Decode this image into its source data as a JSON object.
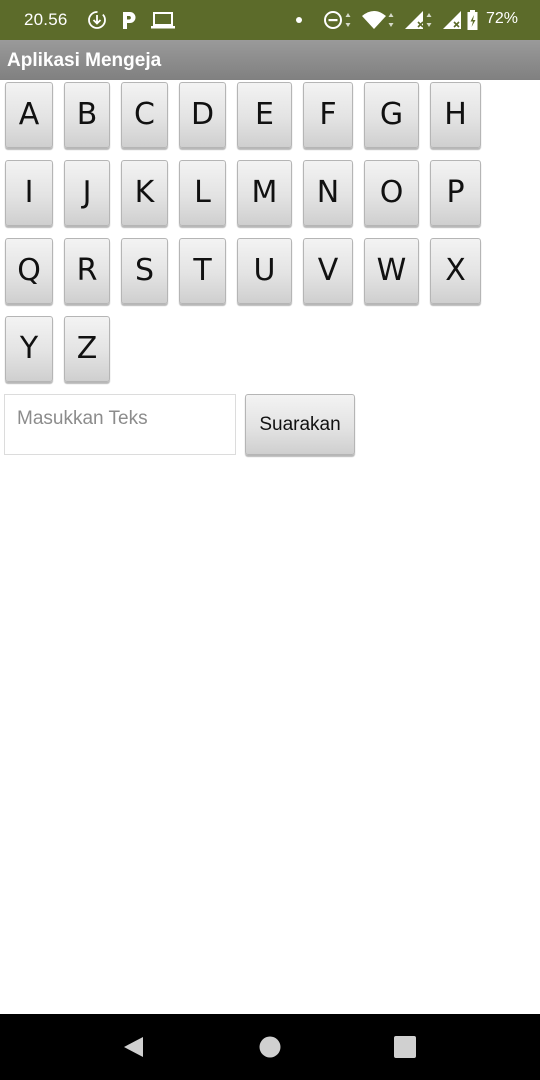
{
  "status_bar": {
    "time": "20.56",
    "battery": "72%",
    "icons": [
      "download-icon",
      "parking-p-icon",
      "laptop-icon",
      "notification-dot-icon",
      "do-not-disturb-icon",
      "wifi-icon",
      "signal-icon",
      "signal-no-sim-icon",
      "battery-icon"
    ],
    "background": "#5c6b2a"
  },
  "title_bar": {
    "title": "Aplikasi Mengeja"
  },
  "letters": [
    "A",
    "B",
    "C",
    "D",
    "E",
    "F",
    "G",
    "H",
    "I",
    "J",
    "K",
    "L",
    "M",
    "N",
    "O",
    "P",
    "Q",
    "R",
    "S",
    "T",
    "U",
    "V",
    "W",
    "X",
    "Y",
    "Z"
  ],
  "input": {
    "placeholder": "Masukkan Teks"
  },
  "speak_button": {
    "label": "Suarakan"
  },
  "nav_bar": {
    "icons": [
      "back-icon",
      "home-icon",
      "recents-icon"
    ]
  }
}
